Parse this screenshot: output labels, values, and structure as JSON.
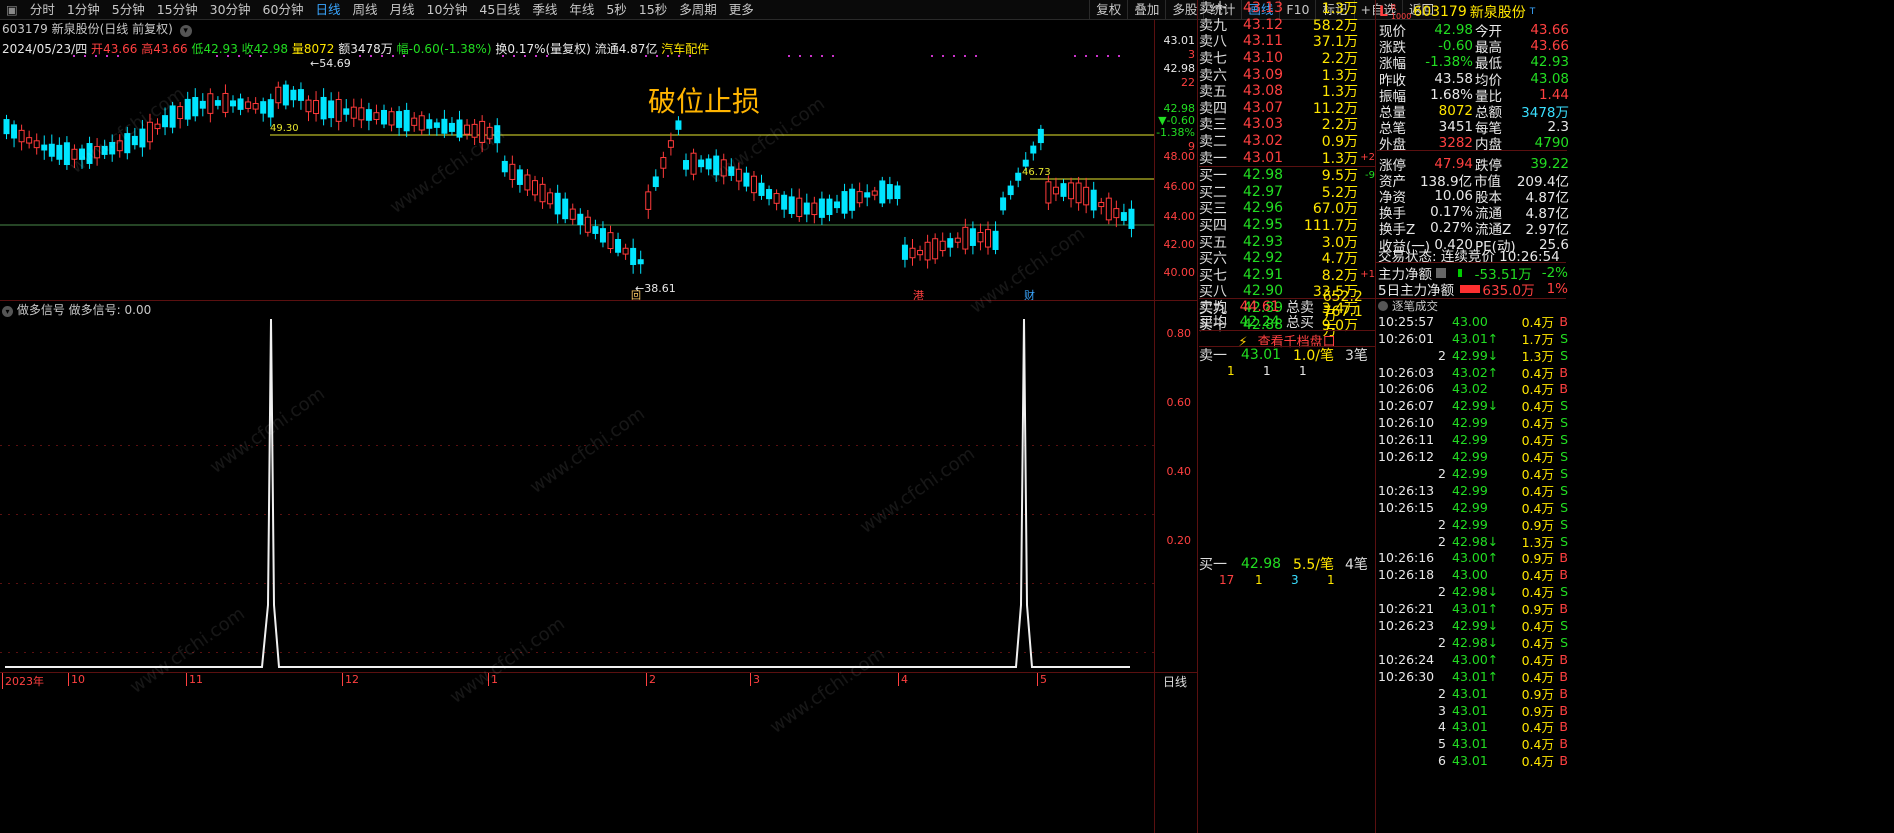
{
  "toolbar": {
    "periods": [
      "分时",
      "1分钟",
      "5分钟",
      "15分钟",
      "30分钟",
      "60分钟",
      "日线",
      "周线",
      "月线",
      "10分钟",
      "45日线",
      "季线",
      "年线",
      "5秒",
      "15秒",
      "多周期",
      "更多"
    ],
    "active_period": "日线",
    "right_buttons": [
      "复权",
      "叠加",
      "多股",
      "统计",
      "画线",
      "F10",
      "标记",
      "+自选",
      "返回"
    ]
  },
  "chart_header": {
    "code_name": "603179 新泉股份(日线 前复权)",
    "date": "2024/05/23/四",
    "open_label": "开",
    "open": "43.66",
    "high_label": "高",
    "high": "43.66",
    "low_label": "低",
    "low": "42.93",
    "close_label": "收",
    "close": "42.98",
    "vol_label": "量",
    "vol": "8072",
    "amt_label": "额",
    "amt": "3478万",
    "chg_label": "幅",
    "chg": "-0.60(-1.38%)",
    "turnover": "换0.17%(量复权)",
    "float": "流通4.87亿",
    "sector": "汽车配件"
  },
  "price_axis": {
    "labels": [
      "43.01",
      "3",
      "42.98",
      "22",
      "42.98",
      "▼-0.60",
      "-1.38%",
      "9",
      "48.00",
      "46.00",
      "44.00",
      "42.00",
      "40.00"
    ]
  },
  "annotation": "破位止损",
  "markers": {
    "high": "54.69",
    "low": "38.61",
    "level": "49.30",
    "right_level": "46.73",
    "m1": "回",
    "m2": "港",
    "m3": "财"
  },
  "indicator": {
    "title": "做多信号  做多信号: 0.00",
    "axis_labels": [
      "0.80",
      "0.60",
      "0.40",
      "0.20"
    ]
  },
  "date_axis": {
    "labels": [
      "2023年",
      "10",
      "11",
      "12",
      "1",
      "2",
      "3",
      "4",
      "5"
    ],
    "period_tag": "日线"
  },
  "order_book": {
    "asks": [
      {
        "label": "卖十",
        "price": "43.13",
        "vol": "1.3万"
      },
      {
        "label": "卖九",
        "price": "43.12",
        "vol": "58.2万"
      },
      {
        "label": "卖八",
        "price": "43.11",
        "vol": "37.1万"
      },
      {
        "label": "卖七",
        "price": "43.10",
        "vol": "2.2万"
      },
      {
        "label": "卖六",
        "price": "43.09",
        "vol": "1.3万"
      },
      {
        "label": "卖五",
        "price": "43.08",
        "vol": "1.3万"
      },
      {
        "label": "卖四",
        "price": "43.07",
        "vol": "11.2万"
      },
      {
        "label": "卖三",
        "price": "43.03",
        "vol": "2.2万"
      },
      {
        "label": "卖二",
        "price": "43.02",
        "vol": "0.9万"
      },
      {
        "label": "卖一",
        "price": "43.01",
        "vol": "1.3万",
        "delta": "+2"
      }
    ],
    "bids": [
      {
        "label": "买一",
        "price": "42.98",
        "vol": "9.5万",
        "delta": "-9"
      },
      {
        "label": "买二",
        "price": "42.97",
        "vol": "5.2万"
      },
      {
        "label": "买三",
        "price": "42.96",
        "vol": "67.0万"
      },
      {
        "label": "买四",
        "price": "42.95",
        "vol": "111.7万"
      },
      {
        "label": "买五",
        "price": "42.93",
        "vol": "3.0万"
      },
      {
        "label": "买六",
        "price": "42.92",
        "vol": "4.7万"
      },
      {
        "label": "买七",
        "price": "42.91",
        "vol": "8.2万",
        "delta": "+1"
      },
      {
        "label": "买八",
        "price": "42.90",
        "vol": "33.5万"
      },
      {
        "label": "买九",
        "price": "42.89",
        "vol": "3.4万"
      },
      {
        "label": "买十",
        "price": "42.88",
        "vol": "9.0万"
      }
    ],
    "avg_sell_label": "卖均",
    "avg_sell": "44.61",
    "total_sell_label": "总卖",
    "total_sell": "652.2万",
    "avg_buy_label": "买均",
    "avg_buy": "42.24",
    "total_buy_label": "总买",
    "total_buy": "767.1万",
    "link": "查看千档盘口",
    "ask1": {
      "label": "卖一",
      "price": "43.01",
      "per": "1.0/笔",
      "count": "3笔",
      "queue": [
        "1",
        "1",
        "1"
      ]
    },
    "bid1": {
      "label": "买一",
      "price": "42.98",
      "per": "5.5/笔",
      "count": "4笔",
      "queue": [
        "17",
        "1",
        "3",
        "1"
      ]
    }
  },
  "quote": {
    "code": "603179",
    "name": "新泉股份",
    "rows": [
      [
        "现价",
        "42.98",
        "今开",
        "43.66"
      ],
      [
        "涨跌",
        "-0.60",
        "最高",
        "43.66"
      ],
      [
        "涨幅",
        "-1.38%",
        "最低",
        "42.93"
      ],
      [
        "昨收",
        "43.58",
        "均价",
        "43.08"
      ],
      [
        "振幅",
        "1.68%",
        "量比",
        "1.44"
      ],
      [
        "总量",
        "8072",
        "总额",
        "3478万"
      ],
      [
        "总笔",
        "3451",
        "每笔",
        "2.3"
      ],
      [
        "外盘",
        "3282",
        "内盘",
        "4790"
      ],
      [
        "涨停",
        "47.94",
        "跌停",
        "39.22"
      ],
      [
        "资产",
        "138.9亿",
        "市值",
        "209.4亿"
      ],
      [
        "净资",
        "10.06",
        "股本",
        "4.87亿"
      ],
      [
        "换手",
        "0.17%",
        "流通",
        "4.87亿"
      ],
      [
        "换手Z",
        "0.27%",
        "流通Z",
        "2.97亿"
      ],
      [
        "收益(一)",
        "0.420",
        "PE(动)",
        "25.6"
      ]
    ],
    "trade_status": "交易状态: 连续竞价 10:26:54",
    "main_flow_label": "主力净额",
    "main_flow": "-53.51万",
    "main_flow_pct": "-2%",
    "flow5_label": "5日主力净额",
    "flow5": "635.0万",
    "flow5_pct": "1%"
  },
  "ticks": {
    "title": "逐笔成交",
    "rows": [
      [
        "10:25:57",
        "43.00",
        "0.4万",
        "B"
      ],
      [
        "10:26:01",
        "43.01↑",
        "1.7万",
        "S"
      ],
      [
        "2",
        "42.99↓",
        "1.3万",
        "S"
      ],
      [
        "10:26:03",
        "43.02↑",
        "0.4万",
        "B"
      ],
      [
        "10:26:06",
        "43.02",
        "0.4万",
        "B"
      ],
      [
        "10:26:07",
        "42.99↓",
        "0.4万",
        "S"
      ],
      [
        "10:26:10",
        "42.99",
        "0.4万",
        "S"
      ],
      [
        "10:26:11",
        "42.99",
        "0.4万",
        "S"
      ],
      [
        "10:26:12",
        "42.99",
        "0.4万",
        "S"
      ],
      [
        "2",
        "42.99",
        "0.4万",
        "S"
      ],
      [
        "10:26:13",
        "42.99",
        "0.4万",
        "S"
      ],
      [
        "10:26:15",
        "42.99",
        "0.4万",
        "S"
      ],
      [
        "2",
        "42.99",
        "0.9万",
        "S"
      ],
      [
        "2",
        "42.98↓",
        "1.3万",
        "S"
      ],
      [
        "10:26:16",
        "43.00↑",
        "0.9万",
        "B"
      ],
      [
        "10:26:18",
        "43.00",
        "0.4万",
        "B"
      ],
      [
        "2",
        "42.98↓",
        "0.4万",
        "S"
      ],
      [
        "10:26:21",
        "43.01↑",
        "0.9万",
        "B"
      ],
      [
        "10:26:23",
        "42.99↓",
        "0.4万",
        "S"
      ],
      [
        "2",
        "42.98↓",
        "0.4万",
        "S"
      ],
      [
        "10:26:24",
        "43.00↑",
        "0.4万",
        "B"
      ],
      [
        "10:26:30",
        "43.01↑",
        "0.4万",
        "B"
      ],
      [
        "2",
        "43.01",
        "0.9万",
        "B"
      ],
      [
        "3",
        "43.01",
        "0.9万",
        "B"
      ],
      [
        "4",
        "43.01",
        "0.4万",
        "B"
      ],
      [
        "5",
        "43.01",
        "0.4万",
        "B"
      ],
      [
        "6",
        "43.01",
        "0.4万",
        "B"
      ]
    ]
  },
  "watermark": "www.cfchi.com",
  "colors": {
    "up": "#ff3a3a",
    "down": "#00e5ff",
    "accent": "#3aa6ff",
    "yellow": "#ffe600"
  }
}
